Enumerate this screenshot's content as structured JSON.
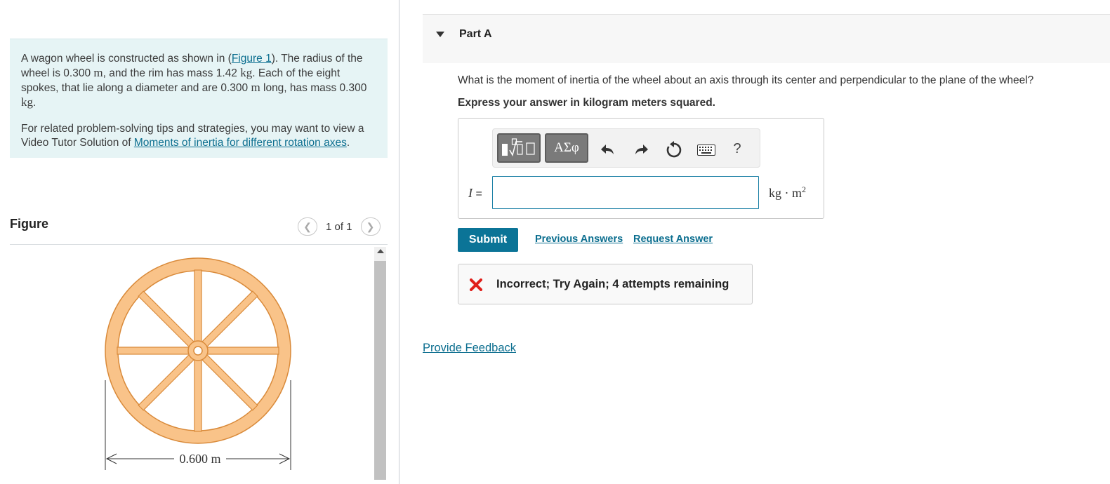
{
  "problem": {
    "p1_a": "A wagon wheel is constructed as shown in (",
    "p1_link": "Figure 1",
    "p1_b": "). The radius of the wheel is 0.300",
    "unit_m": "m",
    "p1_c": ", and the rim has mass 1.42",
    "unit_kg": "kg",
    "p1_d": ". Each of the eight spokes, that lie along a diameter and are 0.300",
    "p1_e": "long, has mass 0.300",
    "p1_f": ".",
    "p2_a": "For related problem-solving tips and strategies, you may want to view a Video Tutor Solution of",
    "p2_link": "Moments of inertia for different rotation axes",
    "p2_b": "."
  },
  "figure": {
    "title": "Figure",
    "page_text": "1 of 1",
    "prev_icon": "chevron-left-icon",
    "next_icon": "chevron-right-icon",
    "dimension_label": "0.600 m",
    "colors": {
      "wheel_fill": "#f9c389",
      "wheel_stroke": "#d98a3a"
    }
  },
  "part": {
    "title": "Part A",
    "question": "What is the moment of inertia of the wheel about an axis through its center and perpendicular to the plane of the wheel?",
    "instruction": "Express your answer in kilogram meters squared."
  },
  "answer": {
    "toolbar": {
      "greek_label": "ΑΣφ",
      "help_label": "?",
      "icons": [
        "templates-icon",
        "greek-letters-icon",
        "undo-icon",
        "redo-icon",
        "reset-icon",
        "keyboard-icon",
        "help-icon"
      ]
    },
    "variable": "I",
    "equals": "=",
    "value": "",
    "unit_base": "kg · m",
    "unit_exp": "2"
  },
  "actions": {
    "submit": "Submit",
    "previous_answers": "Previous Answers",
    "request_answer": "Request Answer"
  },
  "feedback": {
    "message": "Incorrect; Try Again; 4 attempts remaining",
    "status_color": "#e0201b"
  },
  "footer": {
    "provide_feedback": "Provide Feedback"
  },
  "colors": {
    "accent": "#0b7497",
    "link": "#0b6e8f",
    "intro_bg": "#e6f4f5"
  }
}
